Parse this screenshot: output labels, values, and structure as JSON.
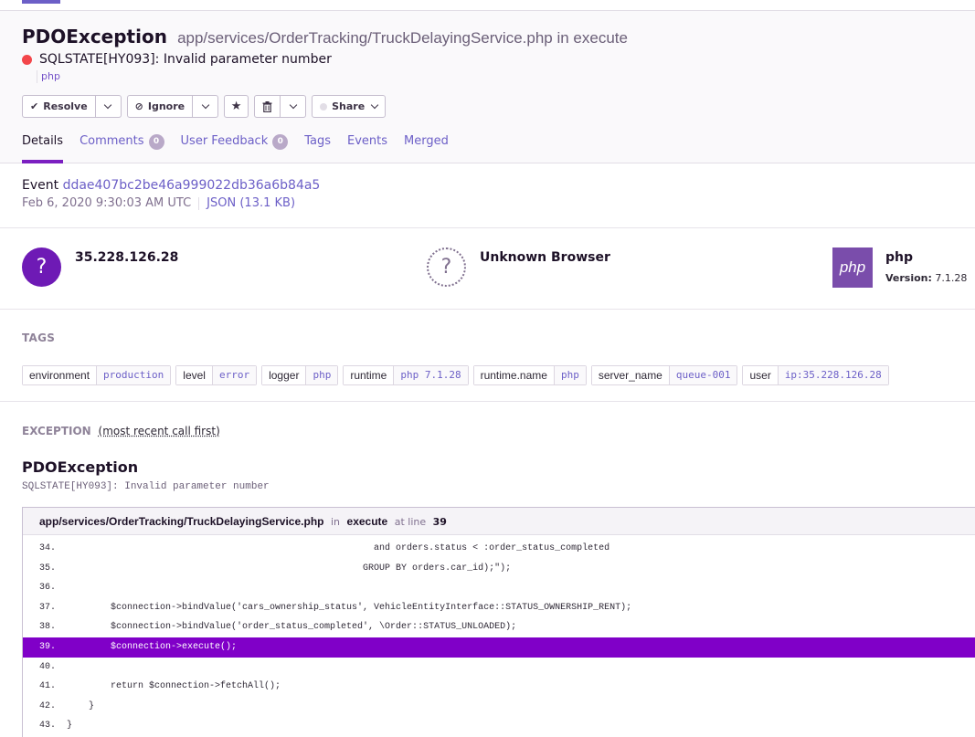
{
  "header": {
    "exception_type": "PDOException",
    "culprit": "app/services/OrderTracking/TruckDelayingService.php in execute",
    "message": "SQLSTATE[HY093]: Invalid parameter number",
    "platform": "php",
    "level_color": "#f3464a"
  },
  "actions": {
    "resolve": "Resolve",
    "ignore": "Ignore",
    "share": "Share"
  },
  "tabs": [
    {
      "label": "Details",
      "active": true
    },
    {
      "label": "Comments",
      "badge": "0"
    },
    {
      "label": "User Feedback",
      "badge": "0"
    },
    {
      "label": "Tags"
    },
    {
      "label": "Events"
    },
    {
      "label": "Merged"
    }
  ],
  "event": {
    "label": "Event",
    "id": "ddae407bc2be46a999022db36a6b84a5",
    "timestamp": "Feb 6, 2020 9:30:03 AM UTC",
    "json_link": "JSON (13.1 KB)"
  },
  "contexts": {
    "user": {
      "icon": "?",
      "title": "35.228.126.28"
    },
    "browser": {
      "icon": "?",
      "title": "Unknown Browser"
    },
    "runtime": {
      "logo": "php",
      "title": "php",
      "version_label": "Version:",
      "version": "7.1.28"
    }
  },
  "tags": {
    "title": "TAGS",
    "items": [
      {
        "key": "environment",
        "value": "production"
      },
      {
        "key": "level",
        "value": "error"
      },
      {
        "key": "logger",
        "value": "php"
      },
      {
        "key": "runtime",
        "value": "php 7.1.28"
      },
      {
        "key": "runtime.name",
        "value": "php"
      },
      {
        "key": "server_name",
        "value": "queue-001"
      },
      {
        "key": "user",
        "value": "ip:35.228.126.28"
      }
    ]
  },
  "exception": {
    "title": "EXCEPTION",
    "subtitle": "(most recent call first)",
    "type": "PDOException",
    "value": "SQLSTATE[HY093]: Invalid parameter number",
    "frame": {
      "file": "app/services/OrderTracking/TruckDelayingService.php",
      "in_label": "in",
      "function": "execute",
      "at_line_label": "at line",
      "line": "39"
    },
    "code_lines": [
      {
        "no": "34.",
        "text": "                                                        and orders.status < :order_status_completed"
      },
      {
        "no": "35.",
        "text": "                                                      GROUP BY orders.car_id);\");"
      },
      {
        "no": "36.",
        "text": ""
      },
      {
        "no": "37.",
        "text": "        $connection->bindValue('cars_ownership_status', VehicleEntityInterface::STATUS_OWNERSHIP_RENT);"
      },
      {
        "no": "38.",
        "text": "        $connection->bindValue('order_status_completed', \\Order::STATUS_UNLOADED);"
      },
      {
        "no": "39.",
        "text": "        $connection->execute();",
        "active": true
      },
      {
        "no": "40.",
        "text": ""
      },
      {
        "no": "41.",
        "text": "        return $connection->fetchAll();"
      },
      {
        "no": "42.",
        "text": "    }"
      },
      {
        "no": "43.",
        "text": "}"
      }
    ]
  }
}
